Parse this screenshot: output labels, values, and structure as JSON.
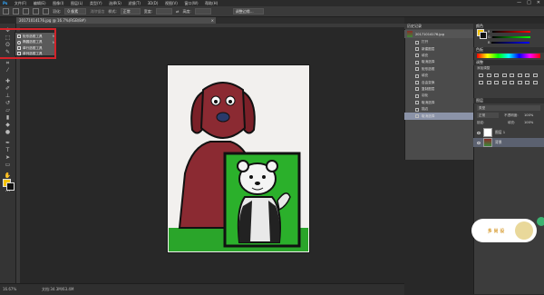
{
  "menubar": {
    "logo": "Ps",
    "items": [
      "文件(F)",
      "编辑(E)",
      "图像(I)",
      "图层(L)",
      "类型(Y)",
      "选择(S)",
      "滤镜(T)",
      "3D(D)",
      "视图(V)",
      "窗口(W)",
      "帮助(H)"
    ]
  },
  "options_bar": {
    "feather_label": "羽化:",
    "feather_value": "0 像素",
    "antialias_label": "消除锯齿",
    "style_label": "样式:",
    "style_value": "正常",
    "width_label": "宽度:",
    "height_label": "高度:",
    "refine_button": "调整边缘..."
  },
  "document_tab": {
    "title": "20171014176.jpg @ 16.7%(RGB/8#)",
    "close": "×"
  },
  "flyout": {
    "items": [
      {
        "label": "矩形选框工具",
        "key": "M"
      },
      {
        "label": "椭圆选框工具",
        "key": "M"
      },
      {
        "label": "单行选框工具",
        "key": ""
      },
      {
        "label": "单列选框工具",
        "key": ""
      }
    ]
  },
  "status": {
    "zoom": "16.67%",
    "docinfo": "文档:34.3M/63.4M"
  },
  "history": {
    "title": "历史记录",
    "snapshot": "20171014176.jpg",
    "rows": [
      "打开",
      "新建图层",
      "填充",
      "取消选择",
      "矩形选框",
      "填充",
      "自由变换",
      "复制图层",
      "羽化",
      "取消选择",
      "描边",
      "取消选择"
    ]
  },
  "color_panel": {
    "title": "颜色",
    "r_label": "R",
    "g_label": "G",
    "b_label": "B",
    "swatches_title": "色板"
  },
  "adjustments": {
    "title": "调整",
    "subtitle": "添加调整"
  },
  "layers": {
    "title": "图层",
    "kind_label": "类型",
    "blend_mode": "正常",
    "opacity_label": "不透明度:",
    "opacity_value": "100%",
    "lock_label": "锁定:",
    "fill_label": "填充:",
    "fill_value": "100%",
    "rows": [
      {
        "name": "图层 1"
      },
      {
        "name": "背景"
      }
    ]
  },
  "watermark": {
    "text": "多 尚 设"
  },
  "colors": {
    "foreground": "#f5c400",
    "background": "#111111",
    "highlight": "#d2232a"
  }
}
